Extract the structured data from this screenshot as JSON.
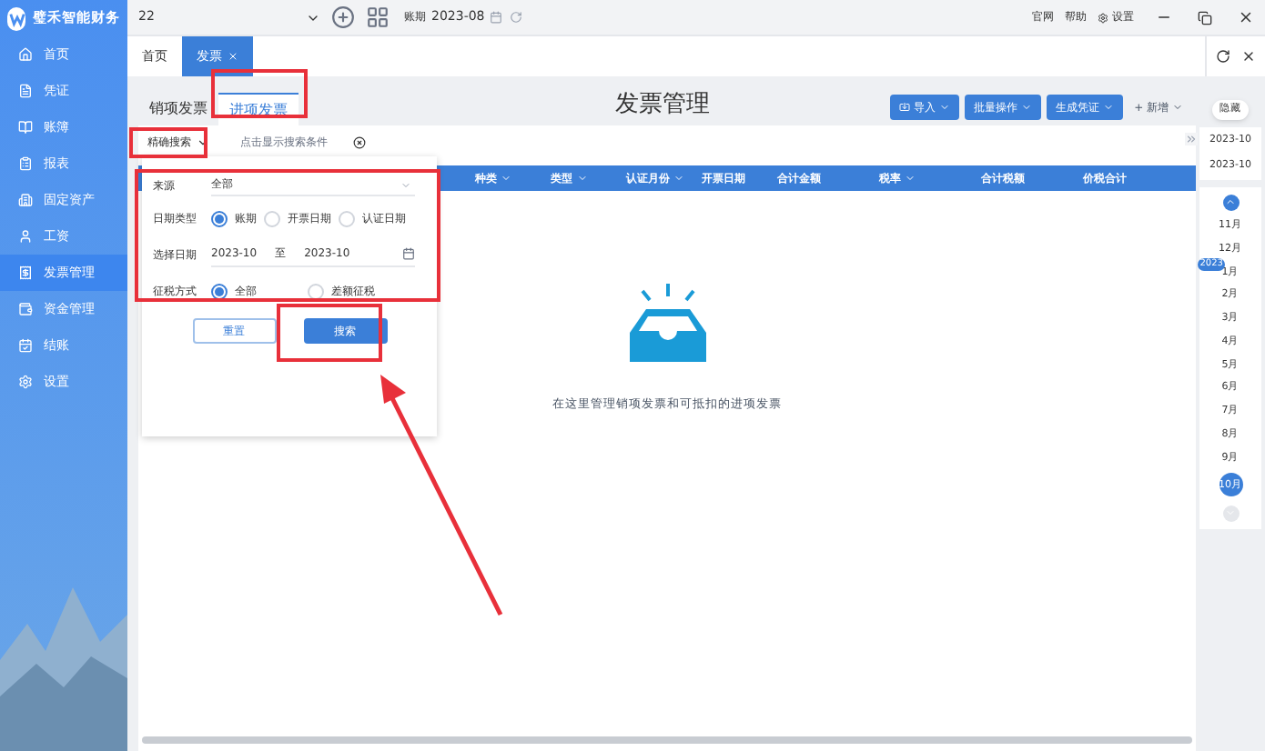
{
  "app": {
    "name": "璧禾智能财务"
  },
  "topbar": {
    "account": "22",
    "period_label": "账期",
    "period": "2023-08",
    "links": [
      "官网",
      "帮助",
      "设置"
    ]
  },
  "sidebar": {
    "items": [
      {
        "label": "首页",
        "selected": false
      },
      {
        "label": "凭证",
        "selected": false
      },
      {
        "label": "账簿",
        "selected": false
      },
      {
        "label": "报表",
        "selected": false
      },
      {
        "label": "固定资产",
        "selected": false
      },
      {
        "label": "工资",
        "selected": false
      },
      {
        "label": "发票管理",
        "selected": true
      },
      {
        "label": "资金管理",
        "selected": false
      },
      {
        "label": "结账",
        "selected": false
      },
      {
        "label": "设置",
        "selected": false
      }
    ]
  },
  "page_tabs": [
    {
      "label": "首页",
      "selected": false,
      "closable": false
    },
    {
      "label": "发票",
      "selected": true,
      "closable": true
    }
  ],
  "invoice_tabs": [
    {
      "label": "销项发票",
      "selected": false
    },
    {
      "label": "进项发票",
      "selected": true
    }
  ],
  "title": "发票管理",
  "actions": [
    {
      "label": "导入",
      "kind": "primary",
      "icon": true
    },
    {
      "label": "批量操作",
      "kind": "primary",
      "icon": false
    },
    {
      "label": "生成凭证",
      "kind": "primary",
      "icon": false
    },
    {
      "label": "+ 新增",
      "kind": "plain",
      "icon": false
    }
  ],
  "search": {
    "mode": "精确搜索",
    "placeholder": "点击显示搜索条件"
  },
  "filter": {
    "source_label": "来源",
    "source": "全部",
    "date_type_label": "日期类型",
    "date_types": [
      {
        "label": "账期",
        "selected": true
      },
      {
        "label": "开票日期",
        "selected": false
      },
      {
        "label": "认证日期",
        "selected": false
      }
    ],
    "date_label": "选择日期",
    "date_from": "2023-10",
    "date_sep": "至",
    "date_to": "2023-10",
    "cert_label": "征税方式",
    "cert_options": [
      {
        "label": "全部",
        "selected": true
      },
      {
        "label": "差额征税",
        "selected": false
      }
    ],
    "reset": "重置",
    "submit": "搜索"
  },
  "table": {
    "columns": [
      {
        "label": "种类",
        "dropdown": true
      },
      {
        "label": "类型",
        "dropdown": true
      },
      {
        "label": "认证月份",
        "dropdown": true
      },
      {
        "label": "开票日期",
        "dropdown": false
      },
      {
        "label": "合计金额",
        "dropdown": false
      },
      {
        "label": "税率",
        "dropdown": true
      },
      {
        "label": "合计税额",
        "dropdown": false
      },
      {
        "label": "价税合计",
        "dropdown": false
      }
    ]
  },
  "empty_text": "在这里管理销项发票和可抵扣的进项发票",
  "calendar": {
    "hide": "隐藏",
    "from": "2023-10",
    "to": "2023-10",
    "year": "2023",
    "months": [
      {
        "label": "11月",
        "selected": false
      },
      {
        "label": "12月",
        "selected": false
      },
      {
        "label": "1月",
        "selected": false
      },
      {
        "label": "2月",
        "selected": false
      },
      {
        "label": "3月",
        "selected": false
      },
      {
        "label": "4月",
        "selected": false
      },
      {
        "label": "5月",
        "selected": false
      },
      {
        "label": "6月",
        "selected": false
      },
      {
        "label": "7月",
        "selected": false
      },
      {
        "label": "8月",
        "selected": false
      },
      {
        "label": "9月",
        "selected": false
      },
      {
        "label": "10月",
        "selected": true
      }
    ]
  }
}
